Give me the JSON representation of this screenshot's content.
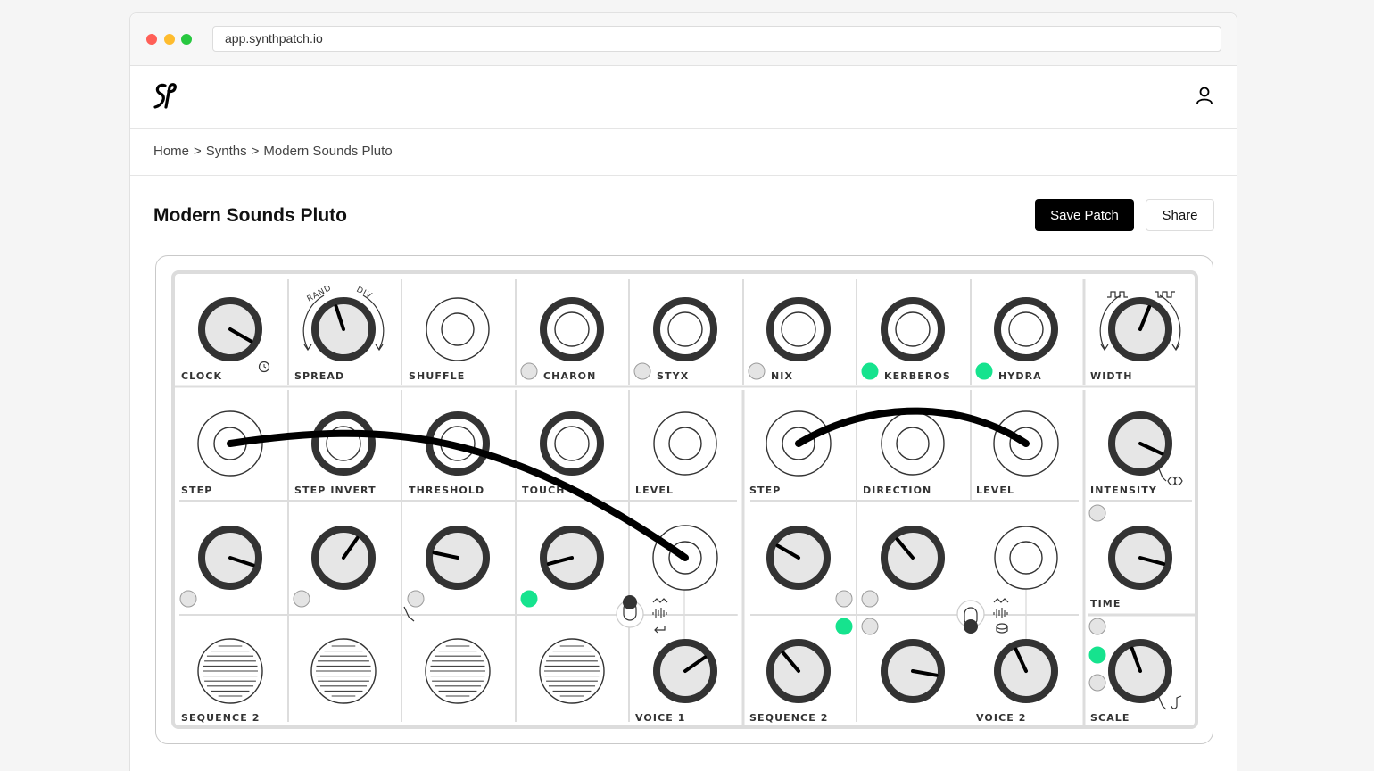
{
  "browser": {
    "url": "app.synthpatch.io"
  },
  "header": {
    "logo": "sp-logo",
    "user_icon": "user-icon"
  },
  "breadcrumb": [
    "Home",
    ">",
    "Synths",
    ">",
    "Modern Sounds Pluto"
  ],
  "page": {
    "title": "Modern Sounds Pluto",
    "save_label": "Save Patch",
    "share_label": "Share"
  },
  "synth": {
    "accent_color": "#16e38e",
    "labels": {
      "clock": "CLOCK",
      "spread": "SPREAD",
      "shuffle": "SHUFFLE",
      "charon": "CHARON",
      "styx": "STYX",
      "nix": "NIX",
      "kerberos": "KERBEROS",
      "hydra": "HYDRA",
      "width": "WIDTH",
      "step_a": "STEP",
      "step_invert": "STEP INVERT",
      "threshold": "THRESHOLD",
      "touch": "TOUCH",
      "level_a": "LEVEL",
      "step_b": "STEP",
      "direction": "DIRECTION",
      "level_b": "LEVEL",
      "intensity": "INTENSITY",
      "time": "TIME",
      "sequence_a": "SEQUENCE 2",
      "voice_1": "VOICE 1",
      "sequence_b": "SEQUENCE 2",
      "voice_2": "VOICE 2",
      "scale": "SCALE",
      "rand": "RAND",
      "div": "DIV"
    }
  }
}
